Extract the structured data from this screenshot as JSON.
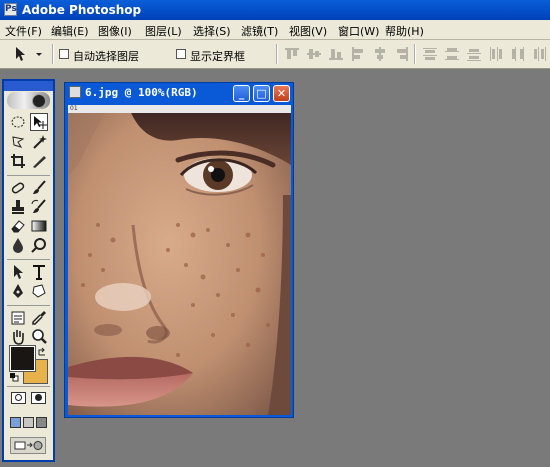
{
  "app": {
    "title": "Adobe Photoshop"
  },
  "menu": [
    "文件(F)",
    "编辑(E)",
    "图像(I)",
    "图层(L)",
    "选择(S)",
    "滤镜(T)",
    "视图(V)",
    "窗口(W)",
    "帮助(H)"
  ],
  "options": {
    "auto_select_layer": "自动选择图层",
    "show_bounding_box": "显示定界框"
  },
  "document": {
    "title": "6.jpg @ 100%(RGB)",
    "ruler_text": "01"
  },
  "colors": {
    "foreground": "#1a1614",
    "background": "#e8b24a",
    "title_bar": "#0a5fd8"
  },
  "toolbox": {
    "tools": [
      "marquee-icon",
      "move-icon",
      "lasso-icon",
      "magic-wand-icon",
      "crop-icon",
      "slice-icon",
      "healing-brush-icon",
      "brush-icon",
      "clone-stamp-icon",
      "history-brush-icon",
      "eraser-icon",
      "gradient-icon",
      "blur-icon",
      "dodge-icon",
      "path-select-icon",
      "type-icon",
      "pen-icon",
      "shape-icon",
      "notes-icon",
      "eyedropper-icon",
      "hand-icon",
      "zoom-icon"
    ]
  }
}
